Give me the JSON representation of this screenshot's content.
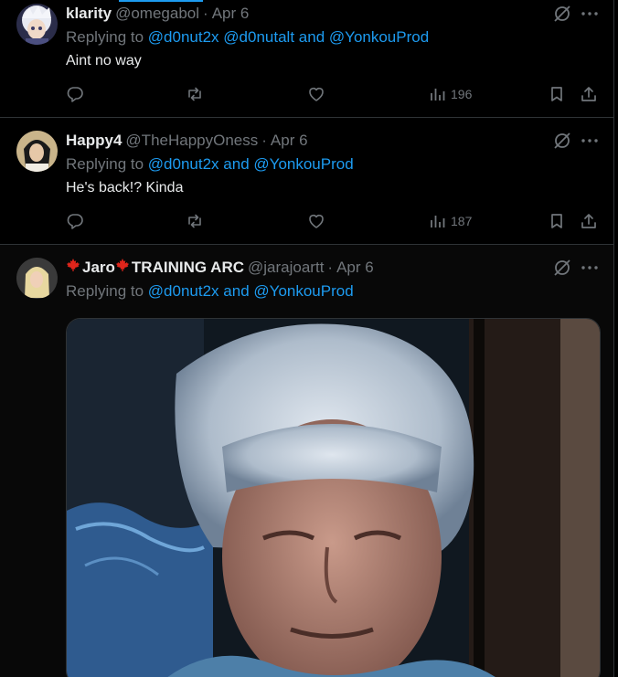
{
  "tweets": [
    {
      "display_name": "klarity",
      "handle": "@omegabol",
      "date": "Apr 6",
      "reply_prefix": "Replying to",
      "mentions": [
        "@d0nut2x",
        "@d0nutalt",
        "@YonkouProd"
      ],
      "connector": "and",
      "text": "Aint no way",
      "views": "196"
    },
    {
      "display_name": "Happy4",
      "handle": "@TheHappyOness",
      "date": "Apr 6",
      "reply_prefix": "Replying to",
      "mentions": [
        "@d0nut2x",
        "@YonkouProd"
      ],
      "connector": "and",
      "text": "He's back!? Kinda",
      "views": "187"
    },
    {
      "display_name_part1": "Jaro",
      "display_name_part2": "TRAINING ARC",
      "handle": "@jarajoartt",
      "date": "Apr 6",
      "reply_prefix": "Replying to",
      "mentions": [
        "@d0nut2x",
        "@YonkouProd"
      ],
      "connector": "and"
    }
  ],
  "separator": "·",
  "icons": {
    "reply": "reply-icon",
    "repost": "repost-icon",
    "like": "heart-icon",
    "views": "analytics-icon",
    "bookmark": "bookmark-icon",
    "share": "share-icon",
    "grok": "grok-icon",
    "more": "more-icon",
    "flag": "maple-leaf-flag-icon"
  },
  "colors": {
    "background": "#000000",
    "text": "#e7e9ea",
    "muted": "#71767b",
    "accent": "#1d9bf0",
    "border": "#2f3336",
    "flag": "#e0251b"
  }
}
